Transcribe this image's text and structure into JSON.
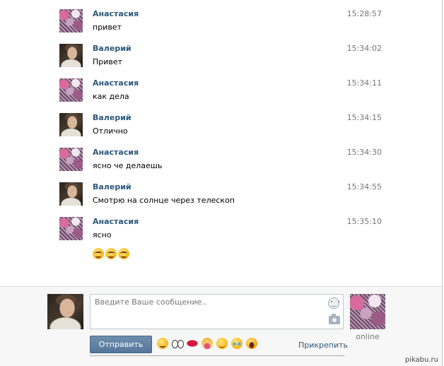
{
  "messages": [
    {
      "author": "Анастасия",
      "time": "15:28:57",
      "text": "привет",
      "avatar": "anastasia"
    },
    {
      "author": "Валерий",
      "time": "15:34:02",
      "text": "Привет",
      "avatar": "valeriy"
    },
    {
      "author": "Анастасия",
      "time": "15:34:11",
      "text": "как дела",
      "avatar": "anastasia"
    },
    {
      "author": "Валерий",
      "time": "15:34:15",
      "text": "Отлично",
      "avatar": "valeriy"
    },
    {
      "author": "Анастасия",
      "time": "15:34:30",
      "text": "ясно че делаешь",
      "avatar": "anastasia"
    },
    {
      "author": "Валерий",
      "time": "15:34:55",
      "text": "Смотрю на солнце через телескоп",
      "avatar": "valeriy"
    },
    {
      "author": "Анастасия",
      "time": "15:35:10",
      "text": "ясно",
      "avatar": "anastasia"
    }
  ],
  "last_message_smiles": [
    "smile-emoji",
    "smile-emoji",
    "smile-emoji"
  ],
  "composer": {
    "placeholder": "Введите Ваше сообщение..",
    "send_label": "Отправить",
    "attach_label": "Прикрепить",
    "peer_status": "online"
  },
  "emoji_bar": [
    "grin-emoji",
    "eyes-emoji",
    "lips-emoji",
    "tongue-emoji",
    "pensive-emoji",
    "cry-emoji",
    "scream-emoji"
  ],
  "watermark": "pikabu.ru",
  "colors": {
    "name": "#2b587a",
    "time": "#777777",
    "button": "#5f80a3",
    "composer_bg": "#f7f7f7"
  }
}
